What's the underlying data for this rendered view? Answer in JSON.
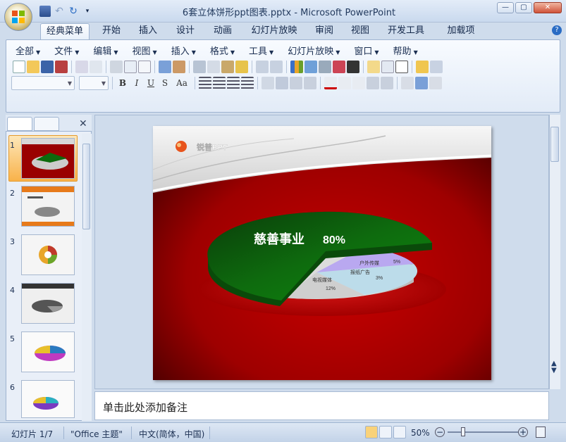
{
  "window": {
    "title": "6套立体饼形ppt图表.pptx - Microsoft PowerPoint",
    "minimize": "—",
    "maximize": "▢",
    "close": "✕"
  },
  "ribbon_tabs": [
    "经典菜单",
    "开始",
    "插入",
    "设计",
    "动画",
    "幻灯片放映",
    "审阅",
    "视图",
    "开发工具",
    "加载项"
  ],
  "menus": [
    "全部",
    "文件",
    "编辑",
    "视图",
    "插入",
    "格式",
    "工具",
    "幻灯片放映",
    "窗口",
    "帮助"
  ],
  "format_buttons": [
    "B",
    "I",
    "U",
    "S",
    "Aa"
  ],
  "help_icon": "?",
  "slides_pane": {
    "close_label": "✕",
    "thumb_numbers": [
      "1",
      "2",
      "3",
      "4",
      "5",
      "6"
    ],
    "selected_index": 1
  },
  "slide": {
    "logo_text": "锐普PPT",
    "chart_title": "慈善事业",
    "chart_value": "80%",
    "labels": [
      {
        "name": "户外传媒",
        "value": "5%"
      },
      {
        "name": "报纸广告",
        "value": "3%"
      },
      {
        "name": "电视媒体",
        "value": "12%"
      }
    ]
  },
  "notes_placeholder": "单击此处添加备注",
  "status": {
    "slide_info": "幻灯片 1/7",
    "theme": "\"Office 主题\"",
    "language": "中文(简体，中国)",
    "zoom": "50%"
  },
  "colors": {
    "accent_green": "#0f6b0f",
    "slide_red": "#a50000"
  }
}
